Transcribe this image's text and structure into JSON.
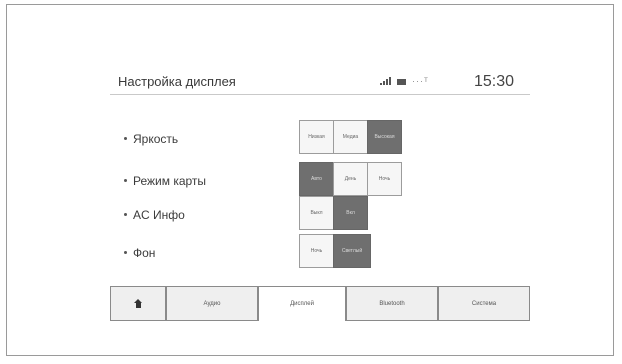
{
  "header": {
    "title": "Настройка дисплея",
    "time": "15:30",
    "status_icons": [
      "signal-icon",
      "battery-icon",
      "wifi-icon"
    ]
  },
  "settings": [
    {
      "label": "Яркость",
      "options": [
        "Низкая",
        "Медиа",
        "Высокая"
      ],
      "selected": "Высокая"
    },
    {
      "label": "Режим карты",
      "options": [
        "Авто",
        "День",
        "Ночь"
      ],
      "selected": "Авто"
    },
    {
      "label": "AC Инфо",
      "options": [
        "Выкл",
        "Вкл"
      ],
      "selected": "Вкл"
    },
    {
      "label": "Фон",
      "options": [
        "Ночь",
        "Светлый"
      ],
      "selected": "Светлый"
    }
  ],
  "navbar": {
    "home_icon": "home-icon",
    "tabs": [
      "Аудио",
      "Дисплей",
      "Bluetooth",
      "Система"
    ],
    "active_tab": "Дисплей"
  },
  "colors": {
    "selected_option": "#6f6f6f",
    "option": "#f6f6f6"
  }
}
